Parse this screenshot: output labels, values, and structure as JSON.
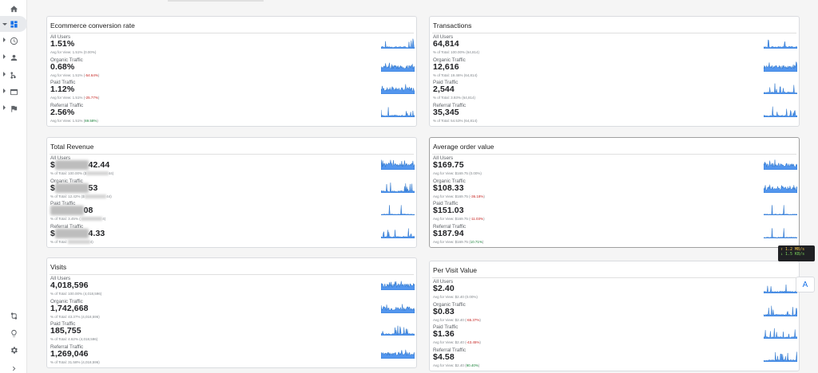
{
  "sidebar": {
    "items": [
      {
        "name": "home-icon"
      },
      {
        "name": "dashboard-icon"
      },
      {
        "name": "clock-icon"
      },
      {
        "name": "person-icon"
      },
      {
        "name": "acquisition-icon"
      },
      {
        "name": "display-icon"
      },
      {
        "name": "flag-icon"
      },
      {
        "name": "route-icon"
      },
      {
        "name": "lightbulb-icon"
      },
      {
        "name": "gear-icon"
      },
      {
        "name": "expand-chevron-icon"
      }
    ]
  },
  "colors": {
    "spark_fill": "#1a73e8",
    "negative": "#c5221f",
    "positive": "#188038",
    "sidebar_active": "#1a73e8"
  },
  "cards": [
    {
      "title": "Ecommerce conversion rate",
      "metrics": [
        {
          "segment": "All Users",
          "value": "1.51%",
          "sub_prefix": "Avg for View: 1.51% (",
          "sub_delta": "0.00%",
          "sub_suffix": ")",
          "delta_type": "neu"
        },
        {
          "segment": "Organic Traffic",
          "value": "0.68%",
          "sub_prefix": "Avg for View: 1.51% (",
          "sub_delta": "-54.64%",
          "sub_suffix": ")",
          "delta_type": "neg"
        },
        {
          "segment": "Paid Traffic",
          "value": "1.12%",
          "sub_prefix": "Avg for View: 1.51% (",
          "sub_delta": "-25.77%",
          "sub_suffix": ")",
          "delta_type": "neg"
        },
        {
          "segment": "Referral Traffic",
          "value": "2.56%",
          "sub_prefix": "Avg for View: 1.51% (",
          "sub_delta": "69.58%",
          "sub_suffix": ")",
          "delta_type": "pos"
        }
      ]
    },
    {
      "title": "Transactions",
      "metrics": [
        {
          "segment": "All Users",
          "value": "64,814",
          "sub_prefix": "% of Total: 100.00% (64,814)",
          "sub_delta": "",
          "sub_suffix": "",
          "delta_type": "neu"
        },
        {
          "segment": "Organic Traffic",
          "value": "12,616",
          "sub_prefix": "% of Total: 19.46% (64,814)",
          "sub_delta": "",
          "sub_suffix": "",
          "delta_type": "neu"
        },
        {
          "segment": "Paid Traffic",
          "value": "2,544",
          "sub_prefix": "% of Total: 3.93% (64,814)",
          "sub_delta": "",
          "sub_suffix": "",
          "delta_type": "neu"
        },
        {
          "segment": "Referral Traffic",
          "value": "35,345",
          "sub_prefix": "% of Total: 54.53% (64,814)",
          "sub_delta": "",
          "sub_suffix": "",
          "delta_type": "neu"
        }
      ]
    },
    {
      "title": "Total Revenue",
      "metrics": [
        {
          "segment": "All Users",
          "value_prefix": "$",
          "value_suffix": "42.44",
          "sub_prefix": "% of Total: 100.00% ($",
          "sub_suffix": "44)"
        },
        {
          "segment": "Organic Traffic",
          "value_prefix": "$",
          "value_suffix": "53",
          "sub_prefix": "% of Total: 12.42% ($",
          "sub_suffix": "44)"
        },
        {
          "segment": "Paid Traffic",
          "value_prefix": "",
          "value_suffix": "08",
          "sub_prefix": "% of Total: 3.45% (",
          "sub_suffix": "4)"
        },
        {
          "segment": "Referral Traffic",
          "value_prefix": "$",
          "value_suffix": "4.33",
          "sub_prefix": "% of Total: ",
          "sub_suffix": "4)"
        }
      ]
    },
    {
      "title": "Average order value",
      "metrics": [
        {
          "segment": "All Users",
          "value": "$169.75",
          "sub_prefix": "Avg for View: $169.75 (",
          "sub_delta": "0.00%",
          "sub_suffix": ")",
          "delta_type": "neu"
        },
        {
          "segment": "Organic Traffic",
          "value": "$108.33",
          "sub_prefix": "Avg for View: $169.75 (",
          "sub_delta": "-36.18%",
          "sub_suffix": ")",
          "delta_type": "neg"
        },
        {
          "segment": "Paid Traffic",
          "value": "$151.03",
          "sub_prefix": "Avg for View: $169.75 (",
          "sub_delta": "-11.03%",
          "sub_suffix": ")",
          "delta_type": "neg"
        },
        {
          "segment": "Referral Traffic",
          "value": "$187.94",
          "sub_prefix": "Avg for View: $169.75 (",
          "sub_delta": "10.71%",
          "sub_suffix": ")",
          "delta_type": "pos"
        }
      ]
    },
    {
      "title": "Visits",
      "metrics": [
        {
          "segment": "All Users",
          "value": "4,018,596",
          "sub_prefix": "% of Total: 100.00% (4,018,596)",
          "sub_delta": "",
          "sub_suffix": "",
          "delta_type": "neu"
        },
        {
          "segment": "Organic Traffic",
          "value": "1,742,668",
          "sub_prefix": "% of Total: 43.37% (4,018,596)",
          "sub_delta": "",
          "sub_suffix": "",
          "delta_type": "neu"
        },
        {
          "segment": "Paid Traffic",
          "value": "185,755",
          "sub_prefix": "% of Total: 4.62% (4,018,596)",
          "sub_delta": "",
          "sub_suffix": "",
          "delta_type": "neu"
        },
        {
          "segment": "Referral Traffic",
          "value": "1,269,046",
          "sub_prefix": "% of Total: 31.58% (4,018,596)",
          "sub_delta": "",
          "sub_suffix": "",
          "delta_type": "neu"
        }
      ]
    },
    {
      "title": "Per Visit Value",
      "metrics": [
        {
          "segment": "All Users",
          "value": "$2.40",
          "sub_prefix": "Avg for View: $2.40 (",
          "sub_delta": "0.00%",
          "sub_suffix": ")",
          "delta_type": "neu"
        },
        {
          "segment": "Organic Traffic",
          "value": "$0.83",
          "sub_prefix": "Avg for View: $2.40 (",
          "sub_delta": "-65.37%",
          "sub_suffix": ")",
          "delta_type": "neg"
        },
        {
          "segment": "Paid Traffic",
          "value": "$1.36",
          "sub_prefix": "Avg for View: $2.40 (",
          "sub_delta": "-43.45%",
          "sub_suffix": ")",
          "delta_type": "neg"
        },
        {
          "segment": "Referral Traffic",
          "value": "$4.58",
          "sub_prefix": "Avg for View: $2.40 (",
          "sub_delta": "90.40%",
          "sub_suffix": ")",
          "delta_type": "pos"
        }
      ]
    }
  ],
  "net_widget": {
    "up": "↑ 1.2 MB/s",
    "down": "↓ 1.5 KB/s"
  },
  "accessibility_button": "A"
}
